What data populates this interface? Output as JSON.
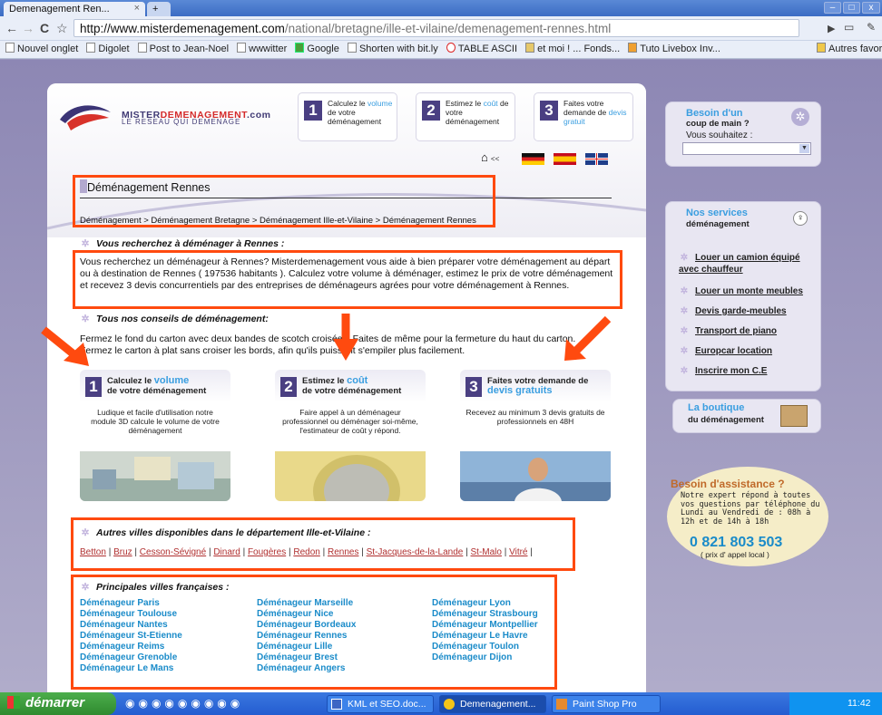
{
  "browser": {
    "tab_title": "Demenagement Ren...",
    "tab_close": "×",
    "new_tab": "+",
    "url_host": "http://www.misterdemenagement.com",
    "url_path": "/national/bretagne/ille-et-vilaine/demenagement-rennes.html",
    "bookmarks": [
      "Nouvel onglet",
      "Digolet",
      "Post to Jean-Noel",
      "wwwitter",
      "Google",
      "Shorten with bit.ly",
      "TABLE ASCII",
      "et moi ! ... Fonds...",
      "Tuto Livebox Inv..."
    ],
    "other_bookmarks": "Autres favoris"
  },
  "header": {
    "logo_title_a": "MISTER",
    "logo_title_b": "DEMENAGEMENT",
    "logo_title_c": ".com",
    "logo_sub": "LE RESEAU QUI DEMENAGE",
    "steps": [
      {
        "num": "1",
        "a": "Calculez le",
        "b": "volume",
        "c": "de votre déménagement"
      },
      {
        "num": "2",
        "a": "Estimez le",
        "b": "coût",
        "c": "de votre déménagement"
      },
      {
        "num": "3",
        "a": "Faites votre demande de",
        "b": "devis gratuit",
        "c": ""
      }
    ],
    "home_link": "<<"
  },
  "main": {
    "title": "Déménagement Rennes",
    "breadcrumb": "Déménagement > Déménagement Bretagne > Déménagement Ille-et-Vilaine > Déménagement Rennes",
    "section1": "Vous recherchez à déménager à Rennes :",
    "intro": "Vous recherchez un déménageur à Rennes? Misterdemenagement vous aide à bien préparer votre déménagement au départ ou à destination de Rennes ( 197536 habitants ). Calculez votre volume à déménager, estimez le prix de votre déménagement et recevez 3 devis concurrentiels par des entreprises de déménageurs agrées pour votre déménagement à Rennes.",
    "section2": "Tous nos conseils de déménagement:",
    "tips": "Fermez le fond du carton avec deux bandes de scotch croisées. Faites de même pour la fermeture du haut du carton. Fermez le carton à plat sans croiser les bords, afin qu'ils puissent s'empiler plus facilement.",
    "cards": [
      {
        "num": "1",
        "a": "Calculez le",
        "b": "volume",
        "c": "de votre déménagement",
        "body": "Ludique et facile d'utilisation notre module 3D calcule le volume de votre déménagement"
      },
      {
        "num": "2",
        "a": "Estimez le",
        "b": "coût",
        "c": "de votre déménagement",
        "body": "Faire appel à un déménageur professionnel ou déménager soi-même, l'estimateur de coût y répond."
      },
      {
        "num": "3",
        "a": "Faites votre demande de",
        "b": "devis gratuits",
        "c": "",
        "body": "Recevez au minimum 3 devis gratuits de professionnels en 48H"
      }
    ],
    "autres_title": "Autres villes disponibles dans le département Ille-et-Vilaine :",
    "autres_links": [
      "Betton",
      "Bruz",
      "Cesson-Sévigné",
      "Dinard",
      "Fougères",
      "Redon",
      "Rennes",
      "St-Jacques-de-la-Lande",
      "St-Malo",
      "Vitré"
    ],
    "principales_title": "Principales villes françaises :",
    "cities_col1": [
      "Déménageur Paris",
      "Déménageur Toulouse",
      "Déménageur Nantes",
      "Déménageur St-Etienne",
      "Déménageur Reims",
      "Déménageur Grenoble",
      "Déménageur Le Mans"
    ],
    "cities_col2": [
      "Déménageur Marseille",
      "Déménageur Nice",
      "Déménageur Bordeaux",
      "Déménageur Rennes",
      "Déménageur Lille",
      "Déménageur Brest",
      "Déménageur Angers"
    ],
    "cities_col3": [
      "Déménageur Lyon",
      "Déménageur Strasbourg",
      "Déménageur Montpellier",
      "Déménageur Le Havre",
      "Déménageur Toulon",
      "Déménageur Dijon"
    ]
  },
  "sidebar": {
    "help_title": "Besoin d'un",
    "help_sub": "coup de main ?",
    "help_label": "Vous souhaitez :",
    "services_title": "Nos services",
    "services_sub": "déménagement",
    "services": [
      "Louer un camion équipé avec chauffeur",
      "Louer un monte meubles",
      "Devis garde-meubles",
      "Transport de piano",
      "Europcar location",
      "Inscrire mon C.E"
    ],
    "shop_title": "La boutique",
    "shop_sub": "du déménagement",
    "assist_title": "Besoin d'assistance ?",
    "assist_text": "Notre expert répond à toutes vos questions par téléphone du Lundi au Vendredi de : 08h à 12h et de 14h à 18h",
    "assist_phone": "0 821 803 503",
    "assist_note": "( prix d' appel local )"
  },
  "taskbar": {
    "start": "démarrer",
    "items": [
      "KML et SEO.doc...",
      "Demenagement...",
      "Paint Shop Pro"
    ],
    "clock": "11:42"
  },
  "colors": {
    "accent_blue": "#3a9ee0",
    "purple": "#4a3f82",
    "annotation": "#ff4a0f"
  }
}
